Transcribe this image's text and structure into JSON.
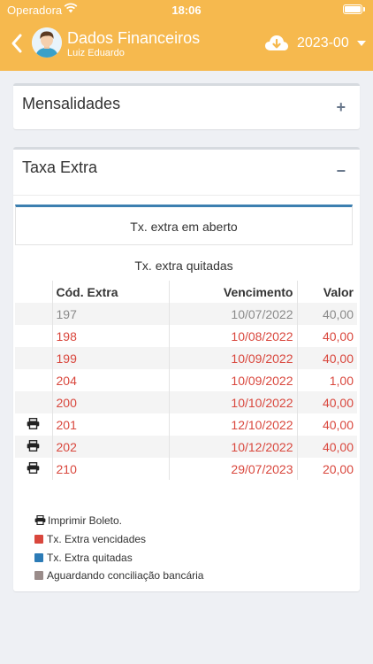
{
  "status": {
    "carrier": "Operadora",
    "time": "18:06"
  },
  "header": {
    "title": "Dados Financeiros",
    "subtitle": "Luiz Eduardo",
    "year": "2023-00"
  },
  "sections": {
    "mensalidades": {
      "title": "Mensalidades",
      "toggle": "+"
    },
    "taxa_extra": {
      "title": "Taxa Extra",
      "toggle": "−"
    }
  },
  "tabs": {
    "open": "Tx. extra em aberto",
    "paid": "Tx. extra quitadas"
  },
  "table": {
    "headers": [
      "",
      "Cód. Extra",
      "Vencimento",
      "Valor"
    ],
    "rows": [
      {
        "code": "197",
        "due": "10/07/2022",
        "value": "40,00",
        "status": "pending",
        "print": false
      },
      {
        "code": "198",
        "due": "10/08/2022",
        "value": "40,00",
        "status": "overdue",
        "print": false
      },
      {
        "code": "199",
        "due": "10/09/2022",
        "value": "40,00",
        "status": "overdue",
        "print": false
      },
      {
        "code": "204",
        "due": "10/09/2022",
        "value": "1,00",
        "status": "overdue",
        "print": false
      },
      {
        "code": "200",
        "due": "10/10/2022",
        "value": "40,00",
        "status": "overdue",
        "print": false
      },
      {
        "code": "201",
        "due": "12/10/2022",
        "value": "40,00",
        "status": "overdue",
        "print": true
      },
      {
        "code": "202",
        "due": "10/12/2022",
        "value": "40,00",
        "status": "overdue",
        "print": true
      },
      {
        "code": "210",
        "due": "29/07/2023",
        "value": "20,00",
        "status": "overdue",
        "print": true
      }
    ]
  },
  "legend": {
    "print": "Imprimir Boleto.",
    "overdue": "Tx. Extra vencidades",
    "paid": "Tx. Extra quitadas",
    "pending": "Aguardando conciliação bancária"
  },
  "colors": {
    "header": "#f6b94e",
    "overdue": "#d9473d",
    "paid": "#2c7bb6",
    "pending": "#9a8c8a",
    "pending_text": "#8a8a8a",
    "tab_accent": "#3c7fb0"
  }
}
